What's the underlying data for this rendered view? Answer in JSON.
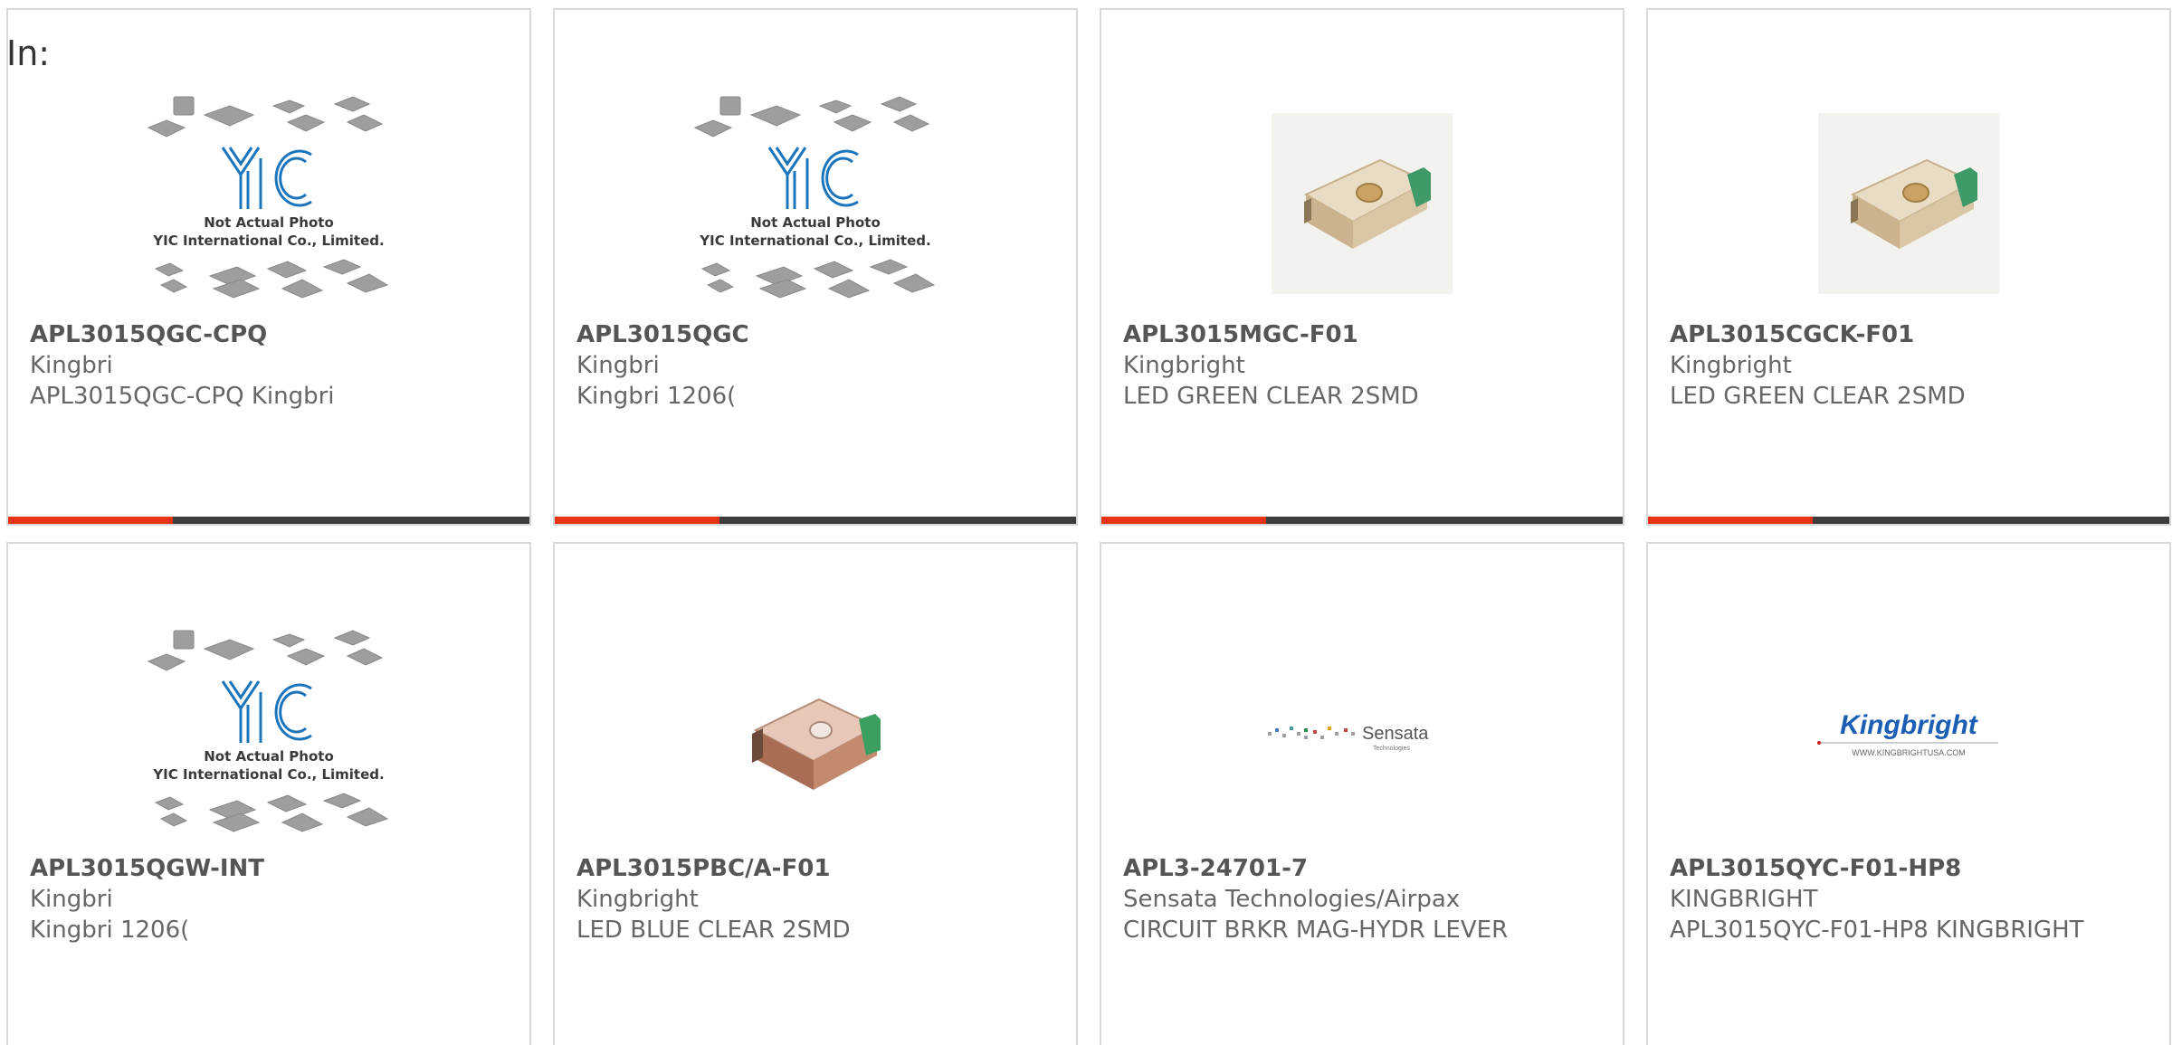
{
  "header": {
    "in_label": "In:"
  },
  "placeholder": {
    "brand": "YIC",
    "line1": "Not Actual Photo",
    "line2": "YIC International Co., Limited."
  },
  "logos": {
    "sensata": "Sensata",
    "sensata_sub": "Technologies",
    "kingbright": "Kingbright",
    "kingbright_url": "WWW.KINGBRIGHTUSA.COM"
  },
  "colors": {
    "accent": "#e63312",
    "bar": "#3d3d3d",
    "border": "#d9d9d9",
    "yic_blue": "#1b75bc",
    "kingbright_blue": "#1a5fb4"
  },
  "products": [
    {
      "part": "APL3015QGC-CPQ",
      "mfr": "Kingbri",
      "desc": "APL3015QGC-CPQ Kingbri",
      "image": "placeholder-yic"
    },
    {
      "part": "APL3015QGC",
      "mfr": "Kingbri",
      "desc": "Kingbri 1206(",
      "image": "placeholder-yic"
    },
    {
      "part": "APL3015MGC-F01",
      "mfr": "Kingbright",
      "desc": "LED GREEN CLEAR 2SMD",
      "image": "smd-led-green"
    },
    {
      "part": "APL3015CGCK-F01",
      "mfr": "Kingbright",
      "desc": "LED GREEN CLEAR 2SMD",
      "image": "smd-led-green"
    },
    {
      "part": "APL3015QGW-INT",
      "mfr": "Kingbri",
      "desc": "Kingbri 1206(",
      "image": "placeholder-yic"
    },
    {
      "part": "APL3015PBC/A-F01",
      "mfr": "Kingbright",
      "desc": "LED BLUE CLEAR 2SMD",
      "image": "smd-led-clear"
    },
    {
      "part": "APL3-24701-7",
      "mfr": "Sensata Technologies/Airpax",
      "desc": "CIRCUIT BRKR MAG-HYDR LEVER",
      "image": "sensata-logo"
    },
    {
      "part": "APL3015QYC-F01-HP8",
      "mfr": "KINGBRIGHT",
      "desc": "APL3015QYC-F01-HP8 KINGBRIGHT",
      "image": "kingbright-logo"
    }
  ]
}
